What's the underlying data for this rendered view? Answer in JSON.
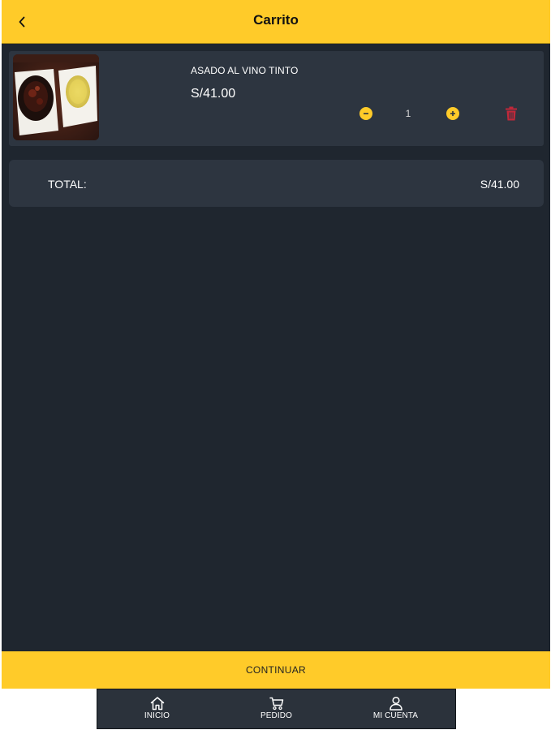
{
  "header": {
    "title": "Carrito",
    "back_icon": "chevron-left-icon"
  },
  "cart": {
    "items": [
      {
        "name": "ASADO AL VINO TINTO",
        "price": "S/41.00",
        "quantity": "1"
      }
    ]
  },
  "total": {
    "label": "TOTAL:",
    "value": "S/41.00"
  },
  "actions": {
    "continue_label": "CONTINUAR"
  },
  "nav": {
    "items": [
      {
        "label": "INICIO",
        "icon": "home-icon"
      },
      {
        "label": "PEDIDO",
        "icon": "cart-icon"
      },
      {
        "label": "MI CUENTA",
        "icon": "user-icon"
      }
    ]
  },
  "colors": {
    "accent": "#ffcb29",
    "background": "#1f262f",
    "card": "#2d3540",
    "danger": "#c0283a"
  }
}
